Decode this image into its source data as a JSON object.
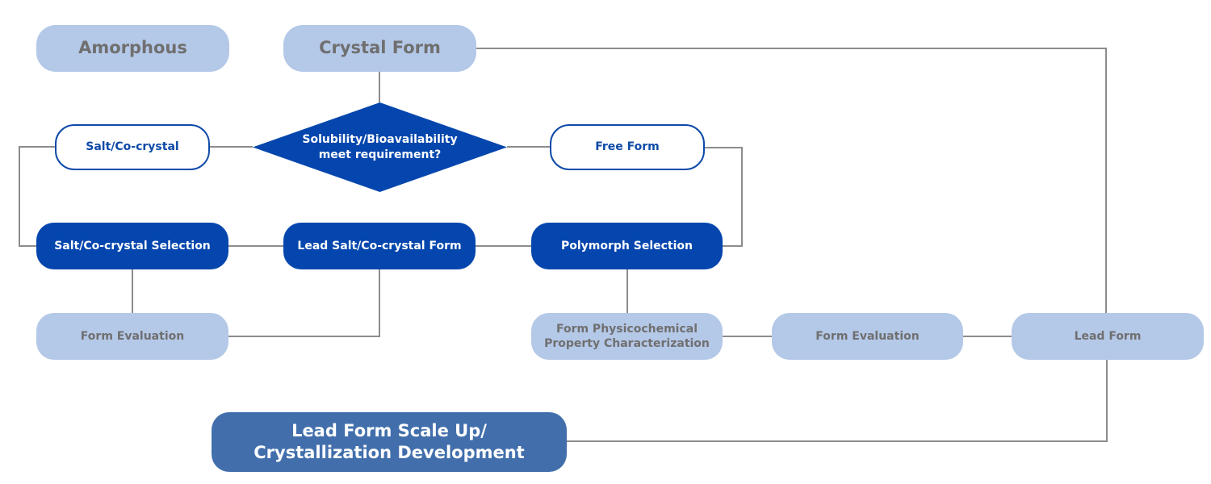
{
  "diagram": {
    "colors": {
      "light_node": "#b4c8e8",
      "light_text": "#6f6f6f",
      "dark_node": "#0446ad",
      "outline": "#0e4aa8",
      "final_node": "#426fac",
      "connector": "#8c8c8c"
    },
    "nodes": {
      "amorphous": "Amorphous",
      "crystal_form": "Crystal Form",
      "decision": [
        "Solubility/Bioavailability",
        "meet requirement?"
      ],
      "salt_cocrystal": "Salt/Co-crystal",
      "free_form": "Free Form",
      "salt_cocrystal_selection": "Salt/Co-crystal Selection",
      "lead_salt_cocrystal_form": "Lead Salt/Co-crystal Form",
      "polymorph_selection": "Polymorph Selection",
      "form_evaluation_left": "Form Evaluation",
      "physicochemical": [
        "Form Physicochemical",
        "Property Characterization"
      ],
      "form_evaluation_right": "Form Evaluation",
      "lead_form": "Lead Form",
      "scale_up": [
        "Lead Form Scale Up/",
        "Crystallization Development"
      ]
    }
  }
}
